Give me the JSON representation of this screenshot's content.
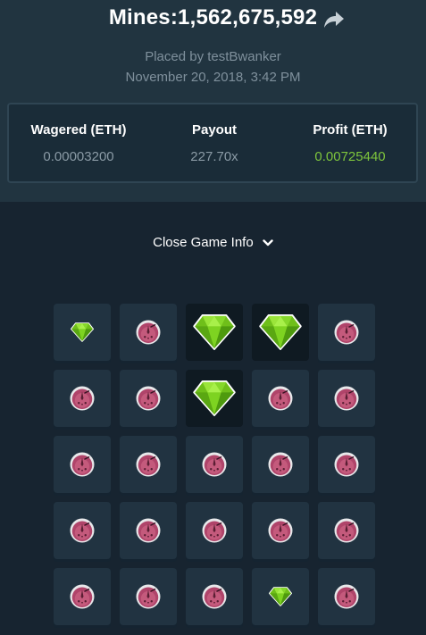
{
  "header": {
    "title": "Mines:1,562,675,592",
    "placed_by": "Placed by testBwanker",
    "datetime": "November 20, 2018, 3:42 PM"
  },
  "stats": {
    "wagered_label": "Wagered (ETH)",
    "wagered_value": "0.00003200",
    "payout_label": "Payout",
    "payout_value": "227.70x",
    "profit_label": "Profit (ETH)",
    "profit_value": "0.00725440"
  },
  "toggle": {
    "label": "Close Game Info"
  },
  "colors": {
    "background": "#172430",
    "header_bg": "#213440",
    "tile": "#213341",
    "revealed_tile": "#0f1a22",
    "gem": "#7ed321",
    "mine": "#b0446a",
    "profit": "#7ec53c"
  },
  "board": {
    "columns": 5,
    "rows": 5,
    "tiles": [
      [
        "gem-small",
        "mine",
        "gem-revealed",
        "gem-revealed",
        "mine"
      ],
      [
        "mine",
        "mine",
        "gem-revealed",
        "mine",
        "mine"
      ],
      [
        "mine",
        "mine",
        "mine",
        "mine",
        "mine"
      ],
      [
        "mine",
        "mine",
        "mine",
        "mine",
        "mine"
      ],
      [
        "mine",
        "mine",
        "mine",
        "gem-small",
        "mine"
      ]
    ]
  }
}
